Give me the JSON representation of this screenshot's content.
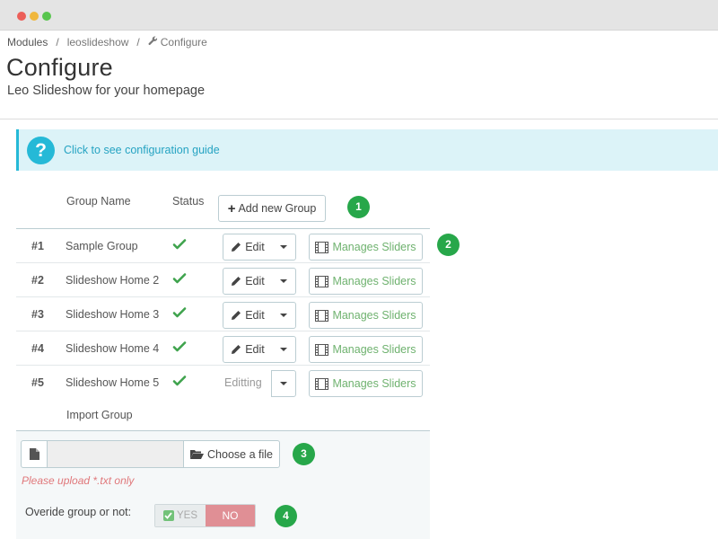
{
  "breadcrumb": {
    "items": [
      "Modules",
      "leoslideshow",
      "Configure"
    ],
    "separator": "/"
  },
  "header": {
    "title": "Configure",
    "subtitle": "Leo Slideshow for your homepage"
  },
  "guide": {
    "icon_text": "?",
    "text": "Click to see configuration guide"
  },
  "table": {
    "headers": {
      "group_name": "Group Name",
      "status": "Status"
    },
    "add_button": "Add new Group",
    "rows": [
      {
        "num": "#1",
        "name": "Sample Group",
        "status": "enabled",
        "edit": "Edit",
        "sliders": "Manages Sliders"
      },
      {
        "num": "#2",
        "name": "Slideshow Home 2",
        "status": "enabled",
        "edit": "Edit",
        "sliders": "Manages Sliders"
      },
      {
        "num": "#3",
        "name": "Slideshow Home 3",
        "status": "enabled",
        "edit": "Edit",
        "sliders": "Manages Sliders"
      },
      {
        "num": "#4",
        "name": "Slideshow Home 4",
        "status": "enabled",
        "edit": "Edit",
        "sliders": "Manages Sliders"
      },
      {
        "num": "#5",
        "name": "Slideshow Home 5",
        "status": "enabled",
        "edit": "Editting",
        "sliders": "Manages Sliders"
      }
    ]
  },
  "import": {
    "label": "Import Group",
    "file_value": "",
    "choose_button": "Choose a file",
    "help": "Please upload *.txt only",
    "override_label": "Overide group or not:",
    "toggle_yes": "YES",
    "toggle_no": "NO",
    "toggle_selected": "NO"
  },
  "badges": [
    "1",
    "2",
    "3",
    "4"
  ],
  "colors": {
    "accent": "#25b9d7",
    "badge": "#27a74a",
    "check": "#3fa34d",
    "sliders_text": "#6fb26f",
    "help_text": "#e0787b",
    "toggle_no": "#e08f95"
  },
  "icons": {
    "window_controls": [
      "close-dot",
      "minimize-dot",
      "maximize-dot"
    ],
    "breadcrumb": "wrench-icon",
    "guide": "question-circle-icon",
    "add": "plus-icon",
    "status": "check-icon",
    "edit": "pencil-icon",
    "dropdown": "caret-down-icon",
    "sliders": "film-icon",
    "file": "file-icon",
    "choose": "folder-open-icon",
    "yes": "checkbox-icon"
  }
}
